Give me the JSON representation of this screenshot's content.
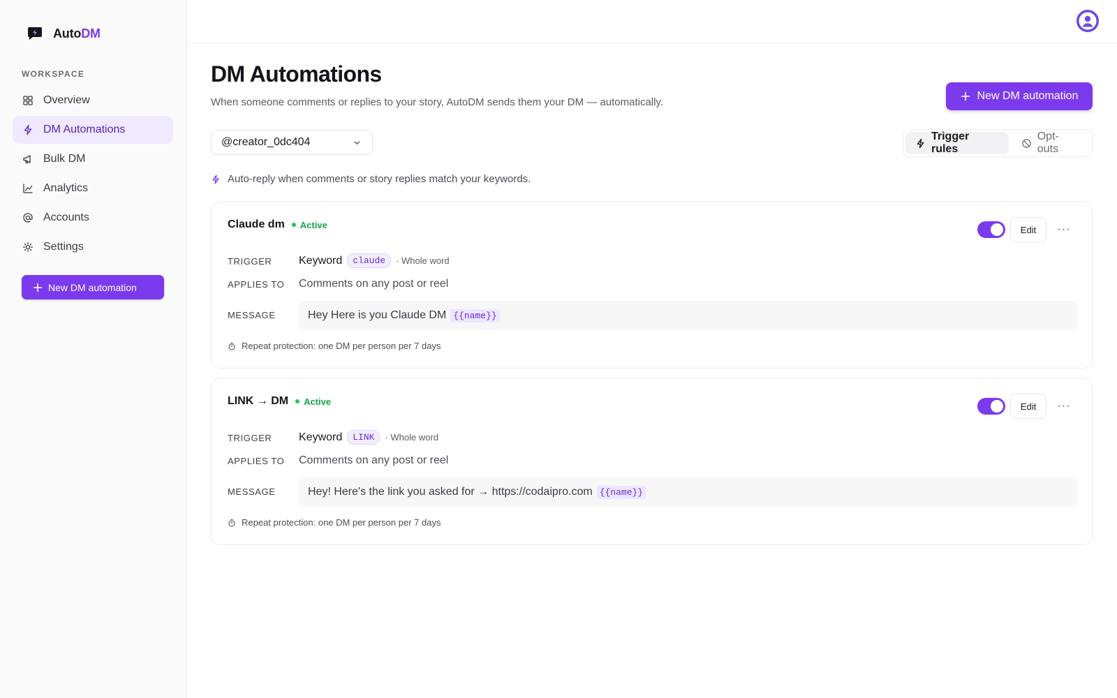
{
  "brand": {
    "name_prefix": "Auto",
    "name_accent": "DM",
    "accent_color": "#7c3aed"
  },
  "sidebar": {
    "section_label": "WORKSPACE",
    "items": [
      {
        "label": "Overview",
        "icon": "grid-icon",
        "active": false
      },
      {
        "label": "DM Automations",
        "icon": "bolt-icon",
        "active": true
      },
      {
        "label": "Bulk DM",
        "icon": "megaphone-icon",
        "active": false
      },
      {
        "label": "Analytics",
        "icon": "chart-line-icon",
        "active": false
      },
      {
        "label": "Accounts",
        "icon": "at-sign-icon",
        "active": false
      },
      {
        "label": "Settings",
        "icon": "gear-icon",
        "active": false
      }
    ],
    "new_button_label": "New DM automation"
  },
  "header": {
    "title": "DM Automations",
    "subtitle": "When someone comments or replies to your story, AutoDM sends them your DM — automatically.",
    "new_button_label": "New DM automation"
  },
  "account_select": {
    "selected": "@creator_0dc404"
  },
  "tabs": [
    {
      "label": "Trigger rules",
      "icon": "bolt-icon",
      "active": true
    },
    {
      "label": "Opt-outs",
      "icon": "ban-icon",
      "active": false
    }
  ],
  "hint": "Auto-reply when comments or story replies match your keywords.",
  "labels": {
    "trigger": "TRIGGER",
    "applies_to": "APPLIES TO",
    "message": "MESSAGE",
    "edit": "Edit"
  },
  "automations": [
    {
      "name": "Claude dm",
      "status": "Active",
      "enabled": true,
      "trigger_type": "Keyword",
      "keyword": "claude",
      "match": "· Whole word",
      "applies_to": "Comments on any post or reel",
      "message": "Hey Here is you Claude DM",
      "variable": "{{name}}",
      "repeat": "Repeat protection: one DM per person per 7 days"
    },
    {
      "name": "LINK → DM",
      "status": "Active",
      "enabled": true,
      "trigger_type": "Keyword",
      "keyword": "LINK",
      "match": "· Whole word",
      "applies_to": "Comments on any post or reel",
      "message": "Hey! Here's the link you asked for → https://codaipro.com",
      "variable": "{{name}}",
      "repeat": "Repeat protection: one DM per person per 7 days"
    }
  ],
  "colors": {
    "accent": "#7c3aed",
    "active_status": "#16a34a",
    "active_nav_bg": "#efeaff"
  }
}
